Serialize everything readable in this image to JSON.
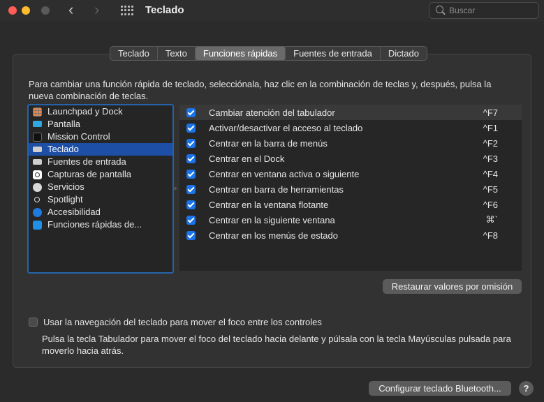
{
  "window": {
    "title": "Teclado"
  },
  "search": {
    "placeholder": "Buscar"
  },
  "tabs": [
    {
      "label": "Teclado"
    },
    {
      "label": "Texto"
    },
    {
      "label": "Funciones rápidas"
    },
    {
      "label": "Fuentes de entrada"
    },
    {
      "label": "Dictado"
    }
  ],
  "description": "Para cambiar una función rápida de teclado, selecciónala, haz clic en la combinación de teclas y, después, pulsa la nueva combinación de teclas.",
  "sidebar": {
    "items": [
      {
        "label": "Launchpad y Dock",
        "icon": "launchpad-icon"
      },
      {
        "label": "Pantalla",
        "icon": "display-icon"
      },
      {
        "label": "Mission Control",
        "icon": "mission-control-icon"
      },
      {
        "label": "Teclado",
        "icon": "keyboard-icon"
      },
      {
        "label": "Fuentes de entrada",
        "icon": "input-sources-icon"
      },
      {
        "label": "Capturas de pantalla",
        "icon": "screenshot-icon"
      },
      {
        "label": "Servicios",
        "icon": "gear-icon"
      },
      {
        "label": "Spotlight",
        "icon": "spotlight-icon"
      },
      {
        "label": "Accesibilidad",
        "icon": "accessibility-icon"
      },
      {
        "label": "Funciones rápidas de...",
        "icon": "app-store-icon"
      }
    ]
  },
  "shortcuts": [
    {
      "label": "Cambiar atención del tabulador",
      "key": "^F7",
      "checked": true
    },
    {
      "label": "Activar/desactivar el acceso al teclado",
      "key": "^F1",
      "checked": true
    },
    {
      "label": "Centrar en la barra de menús",
      "key": "^F2",
      "checked": true
    },
    {
      "label": "Centrar en el Dock",
      "key": "^F3",
      "checked": true
    },
    {
      "label": "Centrar en ventana activa o siguiente",
      "key": "^F4",
      "checked": true
    },
    {
      "label": "Centrar en barra de herramientas",
      "key": "^F5",
      "checked": true
    },
    {
      "label": "Centrar en la ventana flotante",
      "key": "^F6",
      "checked": true
    },
    {
      "label": "Centrar en la siguiente ventana",
      "key": "⌘`",
      "checked": true
    },
    {
      "label": "Centrar en los menús de estado",
      "key": "^F8",
      "checked": true
    }
  ],
  "restore_button": "Restaurar valores por omisión",
  "keyboard_nav": {
    "label": "Usar la navegación del teclado para mover el foco entre los controles",
    "help": "Pulsa la tecla Tabulador para mover el foco del teclado hacia delante y púlsala con la tecla Mayúsculas pulsada para moverlo hacia atrás.",
    "checked": false
  },
  "bluetooth_button": "Configurar teclado Bluetooth...",
  "help_button": "?",
  "colors": {
    "accent": "#1a73e8",
    "selection": "#1d4fa6",
    "focus_ring": "#2563a8"
  }
}
